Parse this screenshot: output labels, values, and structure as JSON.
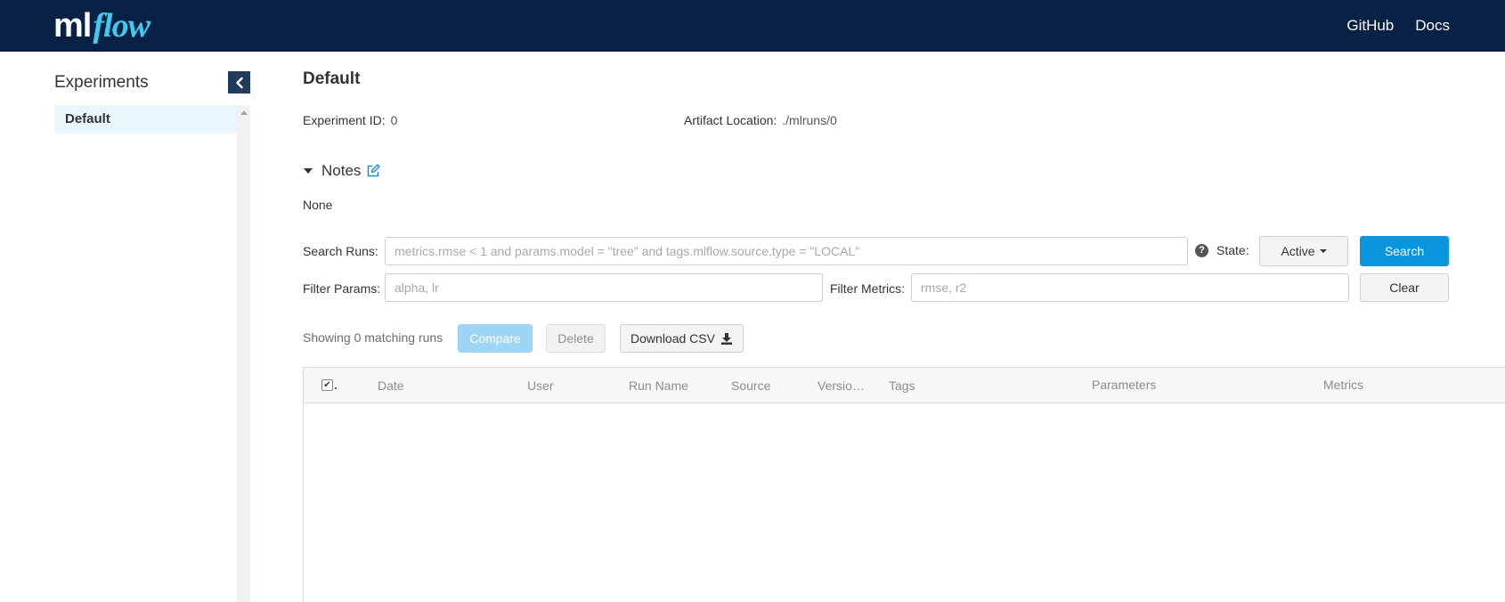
{
  "header": {
    "logo_ml": "ml",
    "logo_flow": "flow",
    "links": [
      "GitHub",
      "Docs"
    ],
    "background": "#082144",
    "logo_accent": "#43C9ED"
  },
  "sidebar": {
    "title": "Experiments",
    "collapse_icon": "chevron-left-icon",
    "experiments": [
      "Default"
    ]
  },
  "experiment": {
    "name": "Default",
    "id_label": "Experiment ID:",
    "id_value": "0",
    "artifact_label": "Artifact Location:",
    "artifact_value": "./mlruns/0",
    "notes_label": "Notes",
    "notes_value": "None"
  },
  "search": {
    "label": "Search Runs:",
    "placeholder": "metrics.rmse < 1 and params.model = \"tree\" and tags.mlflow.source.type = \"LOCAL\"",
    "help": "?",
    "state_label": "State:",
    "state_value": "Active",
    "search_button": "Search",
    "filter_params_label": "Filter Params:",
    "filter_params_placeholder": "alpha, lr",
    "filter_metrics_label": "Filter Metrics:",
    "filter_metrics_placeholder": "rmse, r2",
    "clear_button": "Clear"
  },
  "actions": {
    "showing": "Showing 0 matching runs",
    "compare": "Compare",
    "delete": "Delete",
    "download": "Download CSV"
  },
  "table": {
    "checkbox_glyph": "✔",
    "columns": [
      "Date",
      "User",
      "Run Name",
      "Source",
      "Versio…",
      "Tags",
      "Parameters",
      "Metrics"
    ]
  },
  "colors": {
    "primary": "#0a95df",
    "compare_disabled": "#9fd5f4",
    "selected_row": "#e8f6fd"
  }
}
